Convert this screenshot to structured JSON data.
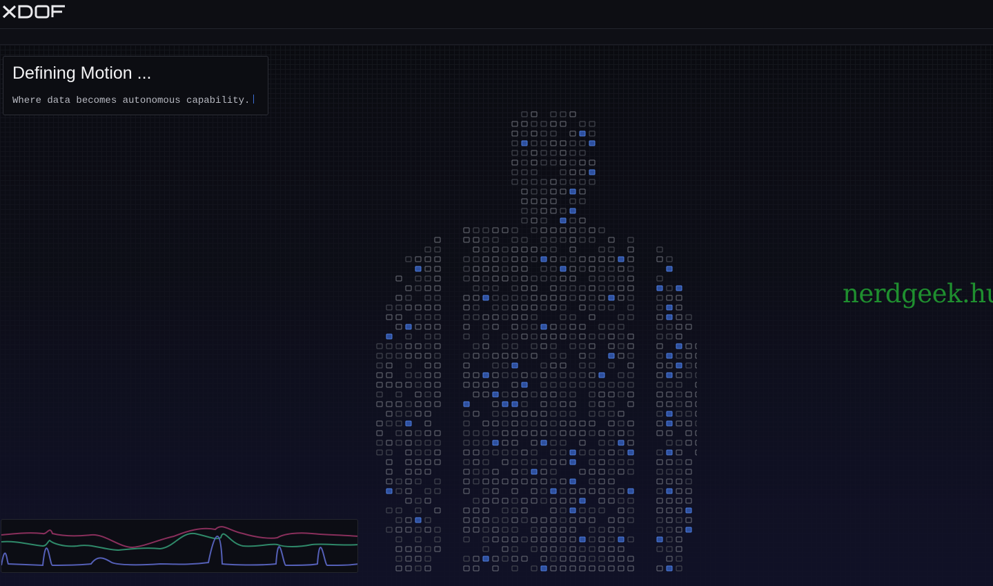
{
  "header": {
    "logo_text": "XDOF"
  },
  "hero": {
    "title": "Defining Motion ...",
    "subtitle": "Where data becomes autonomous capability."
  },
  "watermark": {
    "text": "nerdgeek.hu",
    "color": "#1f8f2f"
  },
  "signal_chart": {
    "type": "line",
    "series_colors": [
      "#2f8a6a",
      "#8a2f5c",
      "#5560b8"
    ]
  },
  "colors": {
    "background": "#0b0c11",
    "accent": "#3d6fd6"
  }
}
